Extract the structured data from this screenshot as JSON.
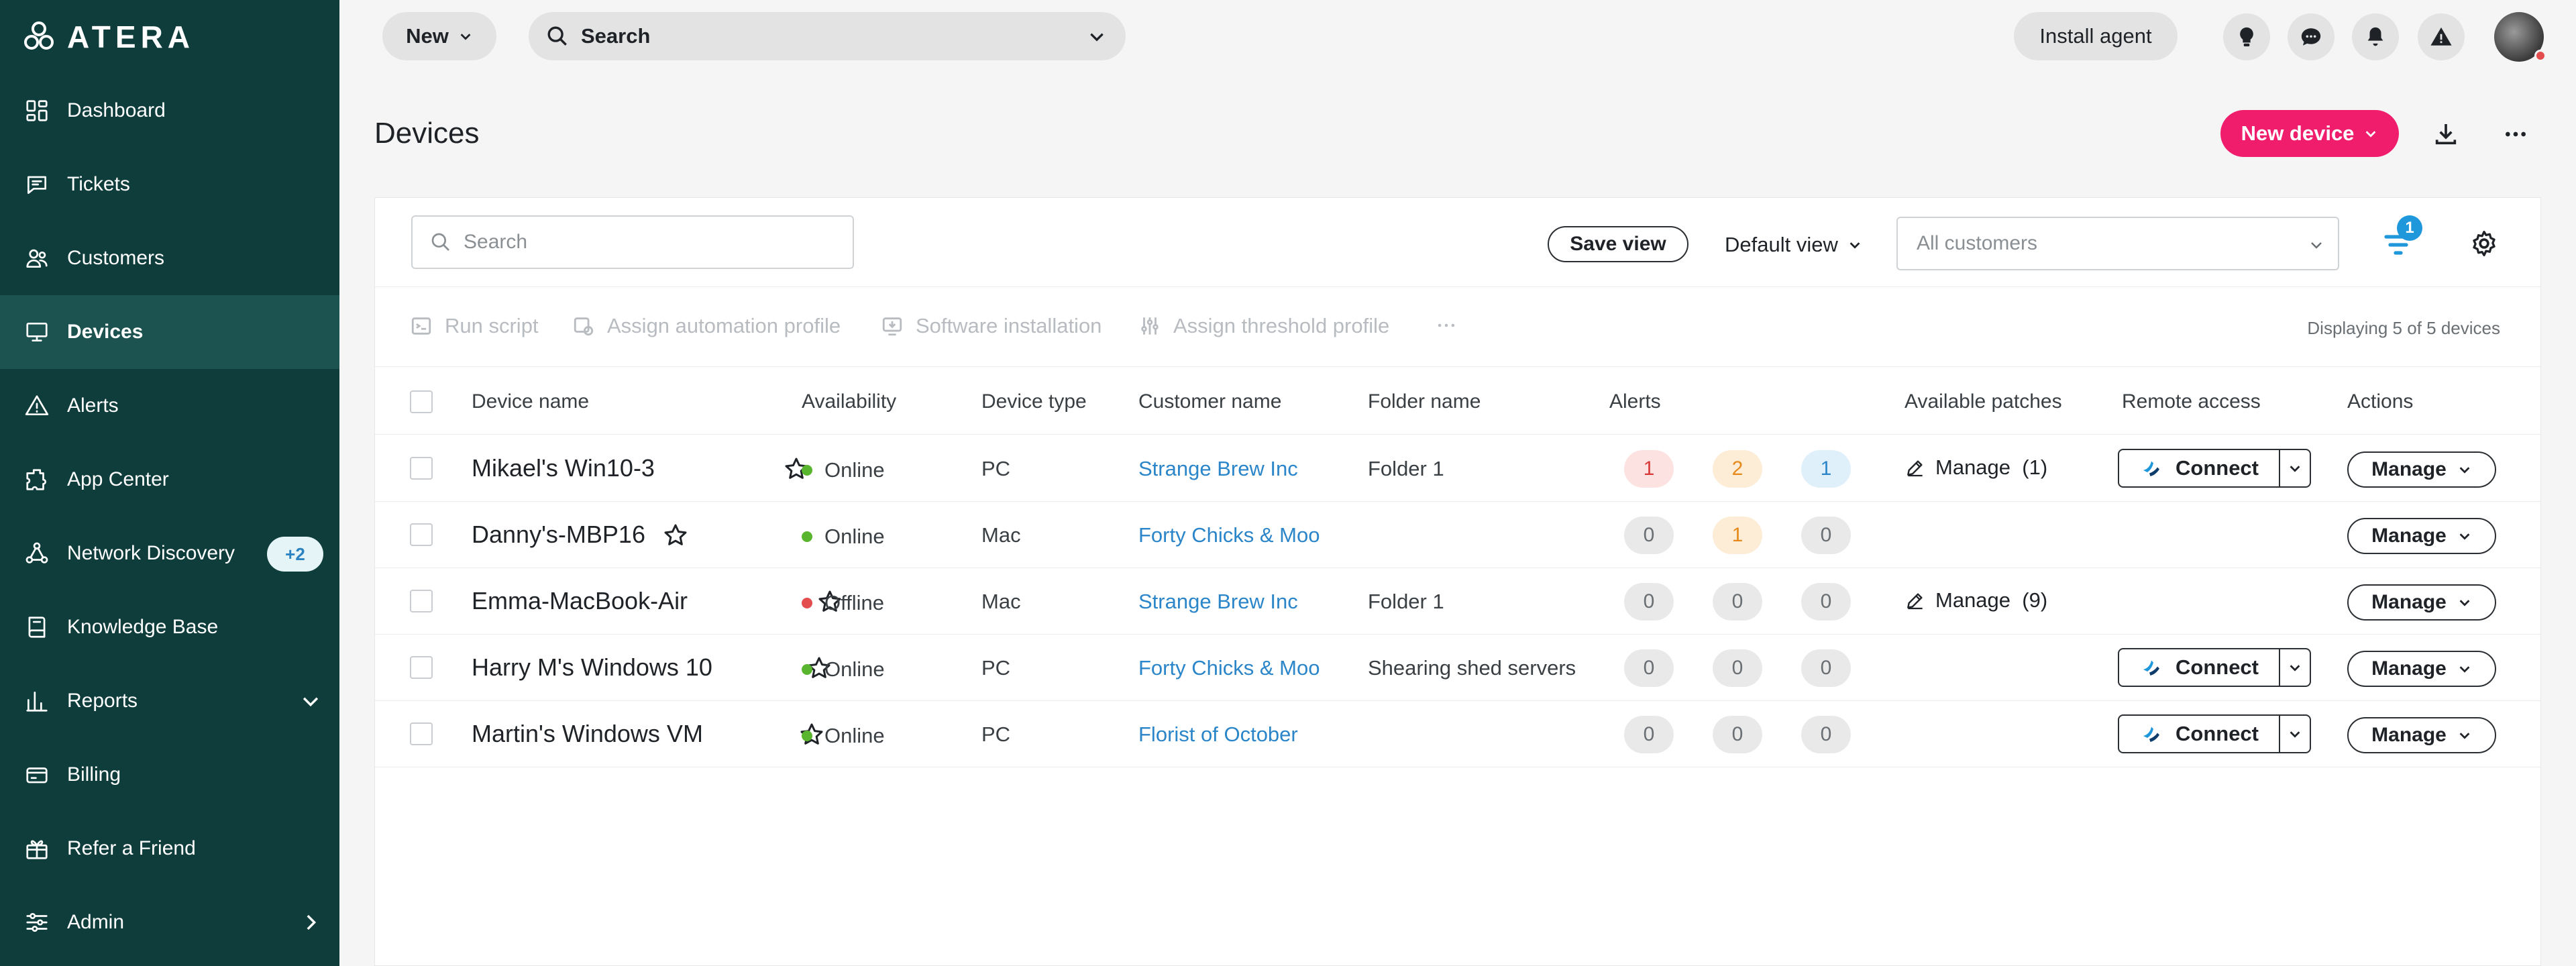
{
  "sidebar": {
    "logo": "ATERA",
    "items": [
      {
        "label": "Dashboard",
        "icon": "dashboard-icon"
      },
      {
        "label": "Tickets",
        "icon": "tickets-icon"
      },
      {
        "label": "Customers",
        "icon": "customers-icon"
      },
      {
        "label": "Devices",
        "icon": "devices-icon",
        "active": true
      },
      {
        "label": "Alerts",
        "icon": "alerts-icon"
      },
      {
        "label": "App Center",
        "icon": "app-center-icon"
      },
      {
        "label": "Network Discovery",
        "icon": "network-discovery-icon",
        "badge": "+2"
      },
      {
        "label": "Knowledge Base",
        "icon": "knowledge-base-icon"
      },
      {
        "label": "Reports",
        "icon": "reports-icon",
        "chevron": "down"
      },
      {
        "label": "Billing",
        "icon": "billing-icon"
      },
      {
        "label": "Refer a Friend",
        "icon": "gift-icon"
      },
      {
        "label": "Admin",
        "icon": "admin-icon",
        "chevron": "right"
      }
    ]
  },
  "topbar": {
    "new_label": "New",
    "search_label": "Search",
    "install_agent_label": "Install agent",
    "icons": [
      "lightbulb-icon",
      "chat-icon",
      "bell-icon",
      "warning-icon"
    ]
  },
  "page": {
    "title": "Devices",
    "new_device_label": "New device"
  },
  "panel": {
    "search_placeholder": "Search",
    "save_view_label": "Save view",
    "default_view_label": "Default view",
    "customers_placeholder": "All customers",
    "filter_count": "1",
    "actions": [
      "Run script",
      "Assign automation profile",
      "Software installation",
      "Assign threshold profile"
    ],
    "displaying": "Displaying 5 of 5 devices"
  },
  "table": {
    "columns": [
      "Device name",
      "Availability",
      "Device type",
      "Customer name",
      "Folder name",
      "Alerts",
      "Available patches",
      "Remote access",
      "Actions"
    ],
    "rows": [
      {
        "name": "Mikael's Win10-3",
        "status": "Online",
        "type": "PC",
        "customer": "Strange Brew Inc",
        "folder": "Folder 1",
        "alerts": [
          "1",
          "2",
          "1"
        ],
        "alert_active": [
          true,
          true,
          true
        ],
        "patches": "Manage  (1)",
        "connect": true,
        "manage": "Manage"
      },
      {
        "name": "Danny's-MBP16",
        "status": "Online",
        "type": "Mac",
        "customer": "Forty Chicks & Moo",
        "folder": "",
        "alerts": [
          "0",
          "1",
          "0"
        ],
        "alert_active": [
          false,
          true,
          false
        ],
        "patches": "",
        "connect": false,
        "manage": "Manage"
      },
      {
        "name": "Emma-MacBook-Air",
        "status": "Offline",
        "type": "Mac",
        "customer": "Strange Brew Inc",
        "folder": "Folder 1",
        "alerts": [
          "0",
          "0",
          "0"
        ],
        "alert_active": [
          false,
          false,
          false
        ],
        "patches": "Manage  (9)",
        "connect": false,
        "manage": "Manage"
      },
      {
        "name": "Harry M's Windows 10",
        "status": "Online",
        "type": "PC",
        "customer": "Forty Chicks & Moo",
        "folder": "Shearing shed servers",
        "alerts": [
          "0",
          "0",
          "0"
        ],
        "alert_active": [
          false,
          false,
          false
        ],
        "patches": "",
        "connect": true,
        "manage": "Manage"
      },
      {
        "name": "Martin's Windows VM",
        "status": "Online",
        "type": "PC",
        "customer": "Florist of October",
        "folder": "",
        "alerts": [
          "0",
          "0",
          "0"
        ],
        "alert_active": [
          false,
          false,
          false
        ],
        "patches": "",
        "connect": true,
        "manage": "Manage"
      }
    ],
    "connect_label": "Connect"
  },
  "colors": {
    "sidebar_bg": "#0e3d3b",
    "sidebar_active": "#1c524f",
    "accent_pink": "#f01d6d",
    "link_blue": "#2b85c9",
    "online_green": "#5ab52e",
    "offline_red": "#e34d4d",
    "alert_critical_bg": "#fde2e2",
    "alert_critical_fg": "#d83a3a",
    "alert_warning_bg": "#fdecd6",
    "alert_warning_fg": "#e58a1a",
    "alert_info_bg": "#dff0fb",
    "alert_info_fg": "#2b85c9",
    "alert_zero_bg": "#e9e9e9",
    "alert_zero_fg": "#6a6f74"
  }
}
